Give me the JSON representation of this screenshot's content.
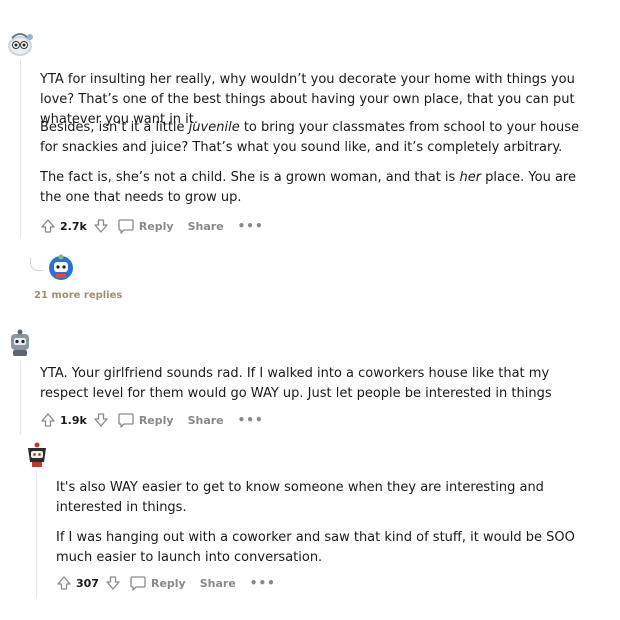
{
  "comments": [
    {
      "paragraphs": [
        [
          "YTA for insulting her really, why wouldn’t you decorate your home with things you love? That’s one of the best things about having your own place, that you can put whatever you want in it."
        ],
        [
          "Besides, isn’t it a little ",
          "juvenile",
          " to bring your classmates from school to your house for snackies and juice? That’s what you sound like, and it’s completely arbitrary."
        ],
        [
          "The fact is, she’s not a child. She is a grown woman, and that is ",
          "her",
          " place. You are the one that needs to grow up."
        ]
      ],
      "votes": "2.7k",
      "reply_label": "Reply",
      "share_label": "Share",
      "more_label": "•••",
      "more_replies": "21 more replies"
    },
    {
      "paragraphs": [
        [
          "YTA. Your girlfriend sounds rad. If I walked into a coworkers house like that my respect level for them would go WAY up. Just let people be interested in things"
        ]
      ],
      "votes": "1.9k",
      "reply_label": "Reply",
      "share_label": "Share",
      "more_label": "•••"
    },
    {
      "paragraphs": [
        [
          "It's also WAY easier to get to know someone when they are interesting and interested in things."
        ],
        [
          "If I was hanging out with a coworker and saw that kind of stuff, it would be SOO much easier to launch into conversation."
        ]
      ],
      "votes": "307",
      "reply_label": "Reply",
      "share_label": "Share",
      "more_label": "•••"
    }
  ],
  "colors": {
    "meta_text": "#878a8c",
    "thread_line": "#e4e6e8",
    "more_replies": "#a08e72"
  }
}
